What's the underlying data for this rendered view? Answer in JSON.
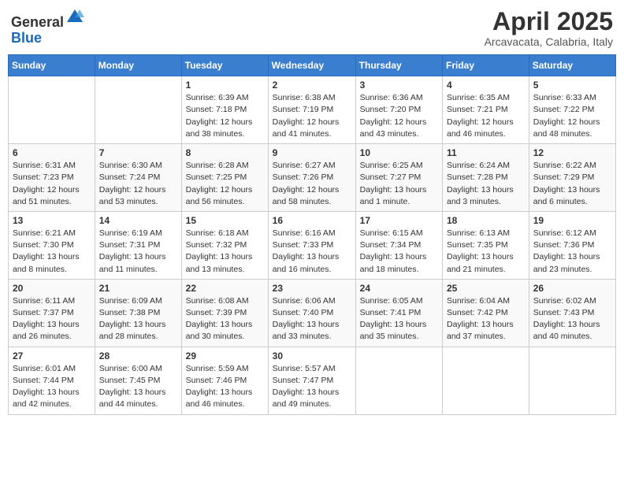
{
  "header": {
    "logo": {
      "line1": "General",
      "line2": "Blue"
    },
    "title": "April 2025",
    "location": "Arcavacata, Calabria, Italy"
  },
  "weekdays": [
    "Sunday",
    "Monday",
    "Tuesday",
    "Wednesday",
    "Thursday",
    "Friday",
    "Saturday"
  ],
  "weeks": [
    [
      {
        "day": "",
        "info": ""
      },
      {
        "day": "",
        "info": ""
      },
      {
        "day": "1",
        "info": "Sunrise: 6:39 AM\nSunset: 7:18 PM\nDaylight: 12 hours\nand 38 minutes."
      },
      {
        "day": "2",
        "info": "Sunrise: 6:38 AM\nSunset: 7:19 PM\nDaylight: 12 hours\nand 41 minutes."
      },
      {
        "day": "3",
        "info": "Sunrise: 6:36 AM\nSunset: 7:20 PM\nDaylight: 12 hours\nand 43 minutes."
      },
      {
        "day": "4",
        "info": "Sunrise: 6:35 AM\nSunset: 7:21 PM\nDaylight: 12 hours\nand 46 minutes."
      },
      {
        "day": "5",
        "info": "Sunrise: 6:33 AM\nSunset: 7:22 PM\nDaylight: 12 hours\nand 48 minutes."
      }
    ],
    [
      {
        "day": "6",
        "info": "Sunrise: 6:31 AM\nSunset: 7:23 PM\nDaylight: 12 hours\nand 51 minutes."
      },
      {
        "day": "7",
        "info": "Sunrise: 6:30 AM\nSunset: 7:24 PM\nDaylight: 12 hours\nand 53 minutes."
      },
      {
        "day": "8",
        "info": "Sunrise: 6:28 AM\nSunset: 7:25 PM\nDaylight: 12 hours\nand 56 minutes."
      },
      {
        "day": "9",
        "info": "Sunrise: 6:27 AM\nSunset: 7:26 PM\nDaylight: 12 hours\nand 58 minutes."
      },
      {
        "day": "10",
        "info": "Sunrise: 6:25 AM\nSunset: 7:27 PM\nDaylight: 13 hours\nand 1 minute."
      },
      {
        "day": "11",
        "info": "Sunrise: 6:24 AM\nSunset: 7:28 PM\nDaylight: 13 hours\nand 3 minutes."
      },
      {
        "day": "12",
        "info": "Sunrise: 6:22 AM\nSunset: 7:29 PM\nDaylight: 13 hours\nand 6 minutes."
      }
    ],
    [
      {
        "day": "13",
        "info": "Sunrise: 6:21 AM\nSunset: 7:30 PM\nDaylight: 13 hours\nand 8 minutes."
      },
      {
        "day": "14",
        "info": "Sunrise: 6:19 AM\nSunset: 7:31 PM\nDaylight: 13 hours\nand 11 minutes."
      },
      {
        "day": "15",
        "info": "Sunrise: 6:18 AM\nSunset: 7:32 PM\nDaylight: 13 hours\nand 13 minutes."
      },
      {
        "day": "16",
        "info": "Sunrise: 6:16 AM\nSunset: 7:33 PM\nDaylight: 13 hours\nand 16 minutes."
      },
      {
        "day": "17",
        "info": "Sunrise: 6:15 AM\nSunset: 7:34 PM\nDaylight: 13 hours\nand 18 minutes."
      },
      {
        "day": "18",
        "info": "Sunrise: 6:13 AM\nSunset: 7:35 PM\nDaylight: 13 hours\nand 21 minutes."
      },
      {
        "day": "19",
        "info": "Sunrise: 6:12 AM\nSunset: 7:36 PM\nDaylight: 13 hours\nand 23 minutes."
      }
    ],
    [
      {
        "day": "20",
        "info": "Sunrise: 6:11 AM\nSunset: 7:37 PM\nDaylight: 13 hours\nand 26 minutes."
      },
      {
        "day": "21",
        "info": "Sunrise: 6:09 AM\nSunset: 7:38 PM\nDaylight: 13 hours\nand 28 minutes."
      },
      {
        "day": "22",
        "info": "Sunrise: 6:08 AM\nSunset: 7:39 PM\nDaylight: 13 hours\nand 30 minutes."
      },
      {
        "day": "23",
        "info": "Sunrise: 6:06 AM\nSunset: 7:40 PM\nDaylight: 13 hours\nand 33 minutes."
      },
      {
        "day": "24",
        "info": "Sunrise: 6:05 AM\nSunset: 7:41 PM\nDaylight: 13 hours\nand 35 minutes."
      },
      {
        "day": "25",
        "info": "Sunrise: 6:04 AM\nSunset: 7:42 PM\nDaylight: 13 hours\nand 37 minutes."
      },
      {
        "day": "26",
        "info": "Sunrise: 6:02 AM\nSunset: 7:43 PM\nDaylight: 13 hours\nand 40 minutes."
      }
    ],
    [
      {
        "day": "27",
        "info": "Sunrise: 6:01 AM\nSunset: 7:44 PM\nDaylight: 13 hours\nand 42 minutes."
      },
      {
        "day": "28",
        "info": "Sunrise: 6:00 AM\nSunset: 7:45 PM\nDaylight: 13 hours\nand 44 minutes."
      },
      {
        "day": "29",
        "info": "Sunrise: 5:59 AM\nSunset: 7:46 PM\nDaylight: 13 hours\nand 46 minutes."
      },
      {
        "day": "30",
        "info": "Sunrise: 5:57 AM\nSunset: 7:47 PM\nDaylight: 13 hours\nand 49 minutes."
      },
      {
        "day": "",
        "info": ""
      },
      {
        "day": "",
        "info": ""
      },
      {
        "day": "",
        "info": ""
      }
    ]
  ]
}
